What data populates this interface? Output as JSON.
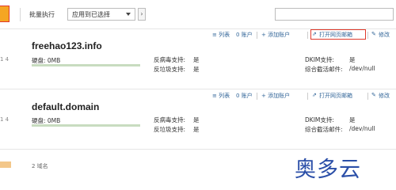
{
  "toolbar": {
    "batch_label": "批量执行",
    "batch_select_value": "应用到已选择",
    "go_label": "›"
  },
  "domains": [
    {
      "row_num": "1 4",
      "name": "freehao123.info",
      "disk": "硬盘: 0MB",
      "disk_usage_fraction": 0,
      "antivirus_label": "反病毒支持:",
      "antivirus_value": "是",
      "antispam_label": "反垃圾支持:",
      "antispam_value": "是",
      "dkim_label": "DKIM支持:",
      "dkim_value": "是",
      "catchall_label": "综合截活邮件:",
      "catchall_value": "/dev/null",
      "actions": {
        "list": "≡ 列表",
        "accounts": "0 账户",
        "add_account": "+ 添加账户",
        "open_webmail": "打开网页邮箱",
        "edit": "修改"
      }
    },
    {
      "row_num": "1 4",
      "name": "default.domain",
      "disk": "硬盘: 0MB",
      "disk_usage_fraction": 0,
      "antivirus_label": "反病毒支持:",
      "antivirus_value": "是",
      "antispam_label": "反垃圾支持:",
      "antispam_value": "是",
      "dkim_label": "DKIM支持:",
      "dkim_value": "是",
      "catchall_label": "综合截活邮件:",
      "catchall_value": "/dev/null",
      "actions": {
        "list": "≡ 列表",
        "accounts": "0 账户",
        "add_account": "+ 添加账户",
        "open_webmail": "打开网页邮箱",
        "edit": "修改"
      }
    }
  ],
  "footer": {
    "count": "2 域名"
  },
  "watermark": "奥多云",
  "colors": {
    "accent_orange": "#f5a623",
    "highlight_red": "#e0392b",
    "link_blue": "#336699",
    "disk_bar_green": "#7fb069"
  },
  "icons": [
    "list-icon",
    "add-icon",
    "external-link-icon",
    "edit-icon",
    "select-arrow-icon"
  ]
}
